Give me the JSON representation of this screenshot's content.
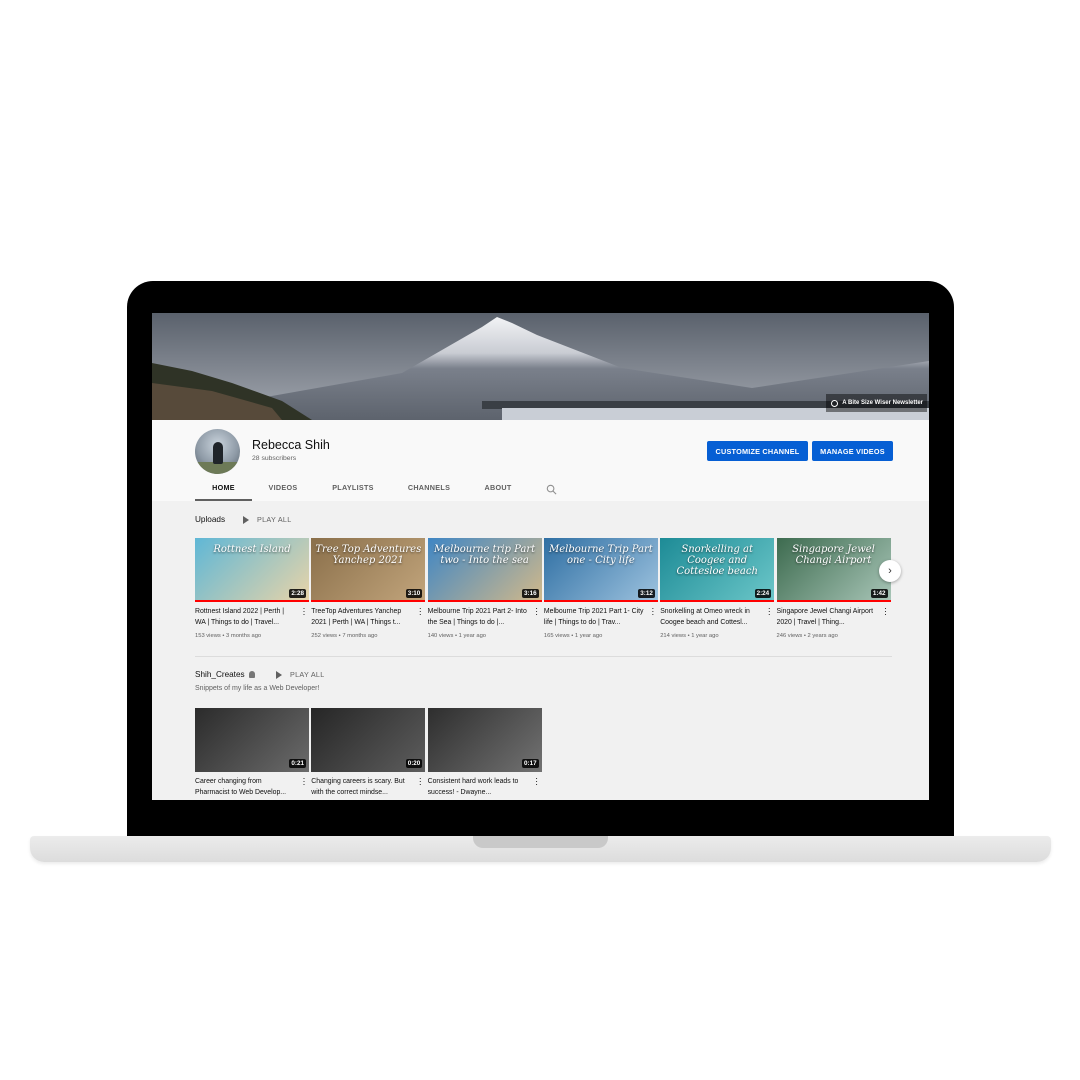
{
  "banner": {
    "link_text": "A Bite Size Wiser Newsletter"
  },
  "channel": {
    "name": "Rebecca Shih",
    "subscribers": "28 subscribers"
  },
  "buttons": {
    "customize": "CUSTOMIZE CHANNEL",
    "manage": "MANAGE VIDEOS"
  },
  "tabs": [
    "HOME",
    "VIDEOS",
    "PLAYLISTS",
    "CHANNELS",
    "ABOUT"
  ],
  "active_tab": "HOME",
  "uploads": {
    "title": "Uploads",
    "play_all": "PLAY ALL",
    "videos": [
      {
        "title": "Rottnest Island 2022 | Perth | WA | Things to do | Travel...",
        "meta": "153 views • 3 months ago",
        "duration": "2:28",
        "overlay": "Rottnest Island",
        "progress": 1.0,
        "colors": [
          "#5fb7d6",
          "#e9d4a8"
        ]
      },
      {
        "title": "TreeTop Adventures Yanchep 2021 | Perth | WA | Things t...",
        "meta": "252 views • 7 months ago",
        "duration": "3:10",
        "overlay": "Tree Top Adventures Yanchep 2021",
        "progress": 1.0,
        "colors": [
          "#8a6f4a",
          "#c2a57c"
        ]
      },
      {
        "title": "Melbourne Trip 2021 Part 2- Into the Sea | Things to do |...",
        "meta": "140 views • 1 year ago",
        "duration": "3:16",
        "overlay": "Melbourne trip Part two - Into the sea",
        "progress": 1.0,
        "colors": [
          "#3f86c4",
          "#d2b98a"
        ]
      },
      {
        "title": "Melbourne Trip 2021 Part 1- City life | Things to do | Trav...",
        "meta": "165 views • 1 year ago",
        "duration": "3:12",
        "overlay": "Melbourne Trip Part one - City life",
        "progress": 1.0,
        "colors": [
          "#2f6fa3",
          "#9ec3df"
        ]
      },
      {
        "title": "Snorkelling at Omeo wreck in Coogee beach and Cottesl...",
        "meta": "214 views • 1 year ago",
        "duration": "2:24",
        "overlay": "Snorkelling at Coogee and Cottesloe beach",
        "progress": 1.0,
        "colors": [
          "#1d8b96",
          "#6cc7c9"
        ]
      },
      {
        "title": "Singapore Jewel Changi Airport 2020 | Travel | Thing...",
        "meta": "246 views • 2 years ago",
        "duration": "1:42",
        "overlay": "Singapore Jewel Changi Airport",
        "progress": 1.0,
        "colors": [
          "#3d6b4f",
          "#a9c6b8"
        ]
      }
    ]
  },
  "playlist": {
    "title": "Shih_Creates",
    "play_all": "PLAY ALL",
    "description": "Snippets of my life as a Web Developer!",
    "videos": [
      {
        "title": "Career changing from Pharmacist to Web Develop...",
        "duration": "0:21",
        "colors": [
          "#2b2b2b",
          "#6b6b6b"
        ]
      },
      {
        "title": "Changing careers is scary. But with the correct mindse...",
        "duration": "0:20",
        "colors": [
          "#262626",
          "#5d5d5d"
        ]
      },
      {
        "title": "Consistent hard work leads to success! - Dwayne...",
        "duration": "0:17",
        "colors": [
          "#2e2e2e",
          "#727272"
        ]
      }
    ]
  }
}
